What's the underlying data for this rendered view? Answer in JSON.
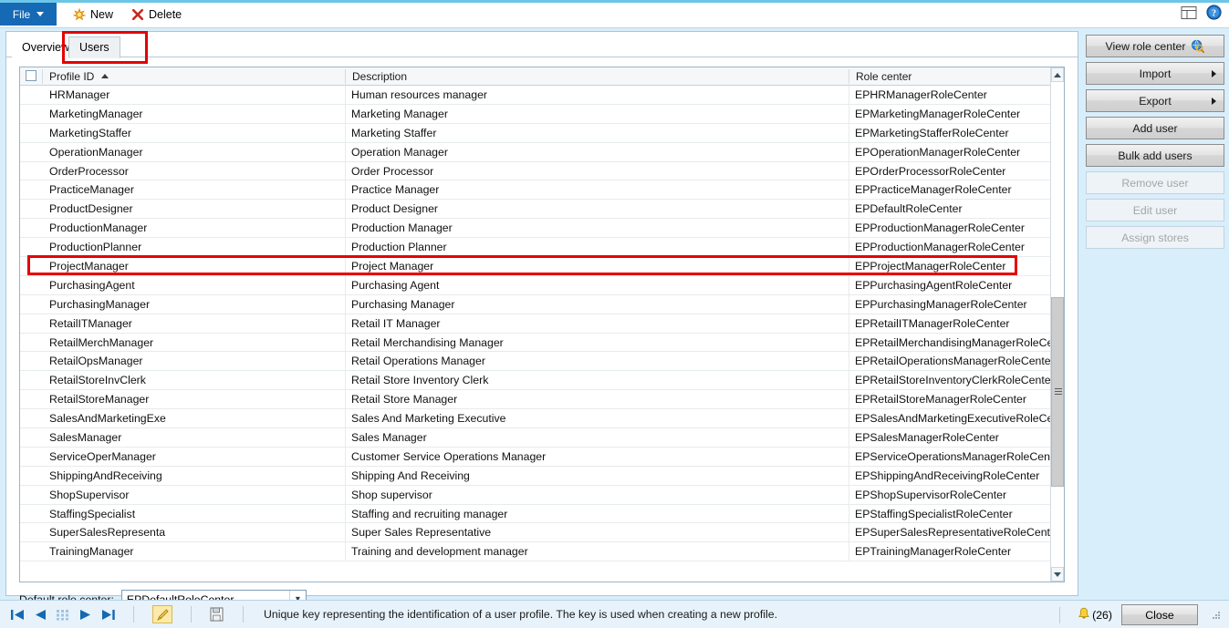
{
  "window": {
    "top_icons": [
      "layout-icon",
      "help-icon"
    ]
  },
  "toolbar": {
    "file_label": "File",
    "new_label": "New",
    "delete_label": "Delete"
  },
  "tabs": [
    {
      "label": "Overview",
      "state": "active"
    },
    {
      "label": "Users",
      "state": "selected"
    }
  ],
  "grid": {
    "columns": [
      "Profile ID",
      "Description",
      "Role center"
    ],
    "sort_column": "Profile ID",
    "sort_direction": "ascending",
    "select_all_checked": false,
    "rows": [
      {
        "profile_id": "HRManager",
        "description": "Human resources manager",
        "role_center": "EPHRManagerRoleCenter"
      },
      {
        "profile_id": "MarketingManager",
        "description": "Marketing Manager",
        "role_center": "EPMarketingManagerRoleCenter"
      },
      {
        "profile_id": "MarketingStaffer",
        "description": "Marketing Staffer",
        "role_center": "EPMarketingStafferRoleCenter"
      },
      {
        "profile_id": "OperationManager",
        "description": "Operation Manager",
        "role_center": "EPOperationManagerRoleCenter"
      },
      {
        "profile_id": "OrderProcessor",
        "description": "Order Processor",
        "role_center": "EPOrderProcessorRoleCenter"
      },
      {
        "profile_id": "PracticeManager",
        "description": "Practice Manager",
        "role_center": "EPPracticeManagerRoleCenter"
      },
      {
        "profile_id": "ProductDesigner",
        "description": "Product Designer",
        "role_center": "EPDefaultRoleCenter"
      },
      {
        "profile_id": "ProductionManager",
        "description": "Production Manager",
        "role_center": "EPProductionManagerRoleCenter"
      },
      {
        "profile_id": "ProductionPlanner",
        "description": "Production Planner",
        "role_center": "EPProductionManagerRoleCenter"
      },
      {
        "profile_id": "ProjectManager",
        "description": "Project Manager",
        "role_center": "EPProjectManagerRoleCenter"
      },
      {
        "profile_id": "PurchasingAgent",
        "description": "Purchasing Agent",
        "role_center": "EPPurchasingAgentRoleCenter"
      },
      {
        "profile_id": "PurchasingManager",
        "description": "Purchasing Manager",
        "role_center": "EPPurchasingManagerRoleCenter"
      },
      {
        "profile_id": "RetailITManager",
        "description": "Retail IT Manager",
        "role_center": "EPRetailITManagerRoleCenter"
      },
      {
        "profile_id": "RetailMerchManager",
        "description": "Retail Merchandising Manager",
        "role_center": "EPRetailMerchandisingManagerRoleCen..."
      },
      {
        "profile_id": "RetailOpsManager",
        "description": "Retail Operations Manager",
        "role_center": "EPRetailOperationsManagerRoleCenter"
      },
      {
        "profile_id": "RetailStoreInvClerk",
        "description": "Retail Store Inventory Clerk",
        "role_center": "EPRetailStoreInventoryClerkRoleCenter"
      },
      {
        "profile_id": "RetailStoreManager",
        "description": "Retail Store Manager",
        "role_center": "EPRetailStoreManagerRoleCenter"
      },
      {
        "profile_id": "SalesAndMarketingExe",
        "description": "Sales And Marketing Executive",
        "role_center": "EPSalesAndMarketingExecutiveRoleCenter"
      },
      {
        "profile_id": "SalesManager",
        "description": "Sales Manager",
        "role_center": "EPSalesManagerRoleCenter"
      },
      {
        "profile_id": "ServiceOperManager",
        "description": "Customer Service Operations Manager",
        "role_center": "EPServiceOperationsManagerRoleCenter"
      },
      {
        "profile_id": "ShippingAndReceiving",
        "description": "Shipping And Receiving",
        "role_center": "EPShippingAndReceivingRoleCenter"
      },
      {
        "profile_id": "ShopSupervisor",
        "description": "Shop supervisor",
        "role_center": "EPShopSupervisorRoleCenter"
      },
      {
        "profile_id": "StaffingSpecialist",
        "description": "Staffing and recruiting manager",
        "role_center": "EPStaffingSpecialistRoleCenter"
      },
      {
        "profile_id": "SuperSalesRepresenta",
        "description": "Super Sales Representative",
        "role_center": "EPSuperSalesRepresentativeRoleCenter"
      },
      {
        "profile_id": "TrainingManager",
        "description": "Training and development manager",
        "role_center": "EPTrainingManagerRoleCenter"
      }
    ],
    "highlighted_row_profile_id": "ProjectManager"
  },
  "default_role_center": {
    "label": "Default role center:",
    "value": "EPDefaultRoleCenter"
  },
  "actions": [
    {
      "label": "View role center",
      "enabled": true,
      "icon": "globe-search-icon",
      "has_submenu": false
    },
    {
      "label": "Import",
      "enabled": true,
      "icon": null,
      "has_submenu": true
    },
    {
      "label": "Export",
      "enabled": true,
      "icon": null,
      "has_submenu": true
    },
    {
      "label": "Add user",
      "enabled": true,
      "icon": null,
      "has_submenu": false
    },
    {
      "label": "Bulk add users",
      "enabled": true,
      "icon": null,
      "has_submenu": false
    },
    {
      "label": "Remove user",
      "enabled": false,
      "icon": null,
      "has_submenu": false
    },
    {
      "label": "Edit user",
      "enabled": false,
      "icon": null,
      "has_submenu": false
    },
    {
      "label": "Assign stores",
      "enabled": false,
      "icon": null,
      "has_submenu": false
    }
  ],
  "statusbar": {
    "message": "Unique key representing the identification of a user profile. The key is used when creating a new profile.",
    "notification_count": "(26)",
    "close_label": "Close",
    "nav_icons": [
      "first-record-icon",
      "previous-record-icon",
      "records-grid-icon",
      "next-record-icon",
      "last-record-icon",
      "edit-icon",
      "save-icon"
    ]
  },
  "colors": {
    "accent_blue": "#1569b5",
    "window_bg": "#d9eefb",
    "highlight_red": "#e60000",
    "statusbar_bg": "#e7f2fa"
  }
}
